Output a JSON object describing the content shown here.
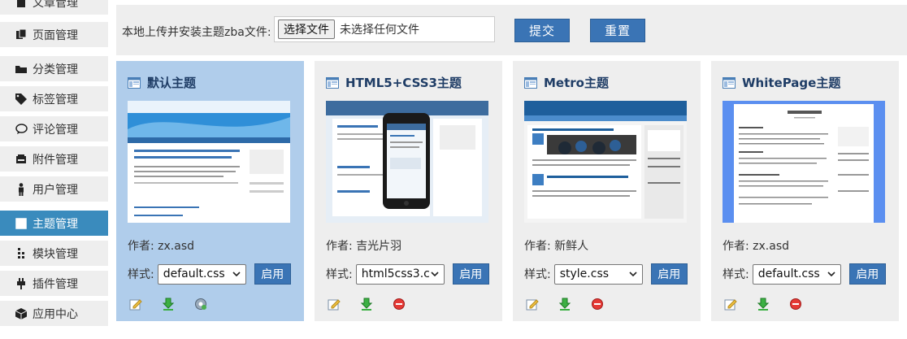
{
  "sidebar": {
    "items": [
      {
        "label": "文章管理",
        "icon": "article-icon"
      },
      {
        "label": "页面管理",
        "icon": "page-icon"
      },
      {
        "label": "分类管理",
        "icon": "folder-icon"
      },
      {
        "label": "标签管理",
        "icon": "tag-icon"
      },
      {
        "label": "评论管理",
        "icon": "comment-icon"
      },
      {
        "label": "附件管理",
        "icon": "attachment-icon"
      },
      {
        "label": "用户管理",
        "icon": "user-icon"
      },
      {
        "label": "主题管理",
        "icon": "theme-icon",
        "active": true
      },
      {
        "label": "模块管理",
        "icon": "module-icon"
      },
      {
        "label": "插件管理",
        "icon": "plugin-icon"
      },
      {
        "label": "应用中心",
        "icon": "app-center-icon"
      }
    ]
  },
  "upload": {
    "label": "本地上传并安装主题zba文件:",
    "choose_button": "选择文件",
    "no_file_text": "未选择任何文件",
    "submit_label": "提交",
    "reset_label": "重置"
  },
  "themes": [
    {
      "name": "默认主题",
      "author_label": "作者:",
      "author": "zx.asd",
      "style_label": "样式:",
      "style": "default.css",
      "enable_label": "启用",
      "selected": true
    },
    {
      "name": "HTML5+CSS3主题",
      "author_label": "作者:",
      "author": "吉光片羽",
      "style_label": "样式:",
      "style": "html5css3.c",
      "enable_label": "启用"
    },
    {
      "name": "Metro主题",
      "author_label": "作者:",
      "author": "新鲜人",
      "style_label": "样式:",
      "style": "style.css",
      "enable_label": "启用"
    },
    {
      "name": "WhitePage主题",
      "author_label": "作者:",
      "author": "zx.asd",
      "style_label": "样式:",
      "style": "default.css",
      "enable_label": "启用"
    }
  ],
  "colors": {
    "accent": "#3a74b5",
    "sidebar_active": "#3a8bbd",
    "selected_card": "#b0cdeb",
    "card_bg": "#eeeeee"
  }
}
